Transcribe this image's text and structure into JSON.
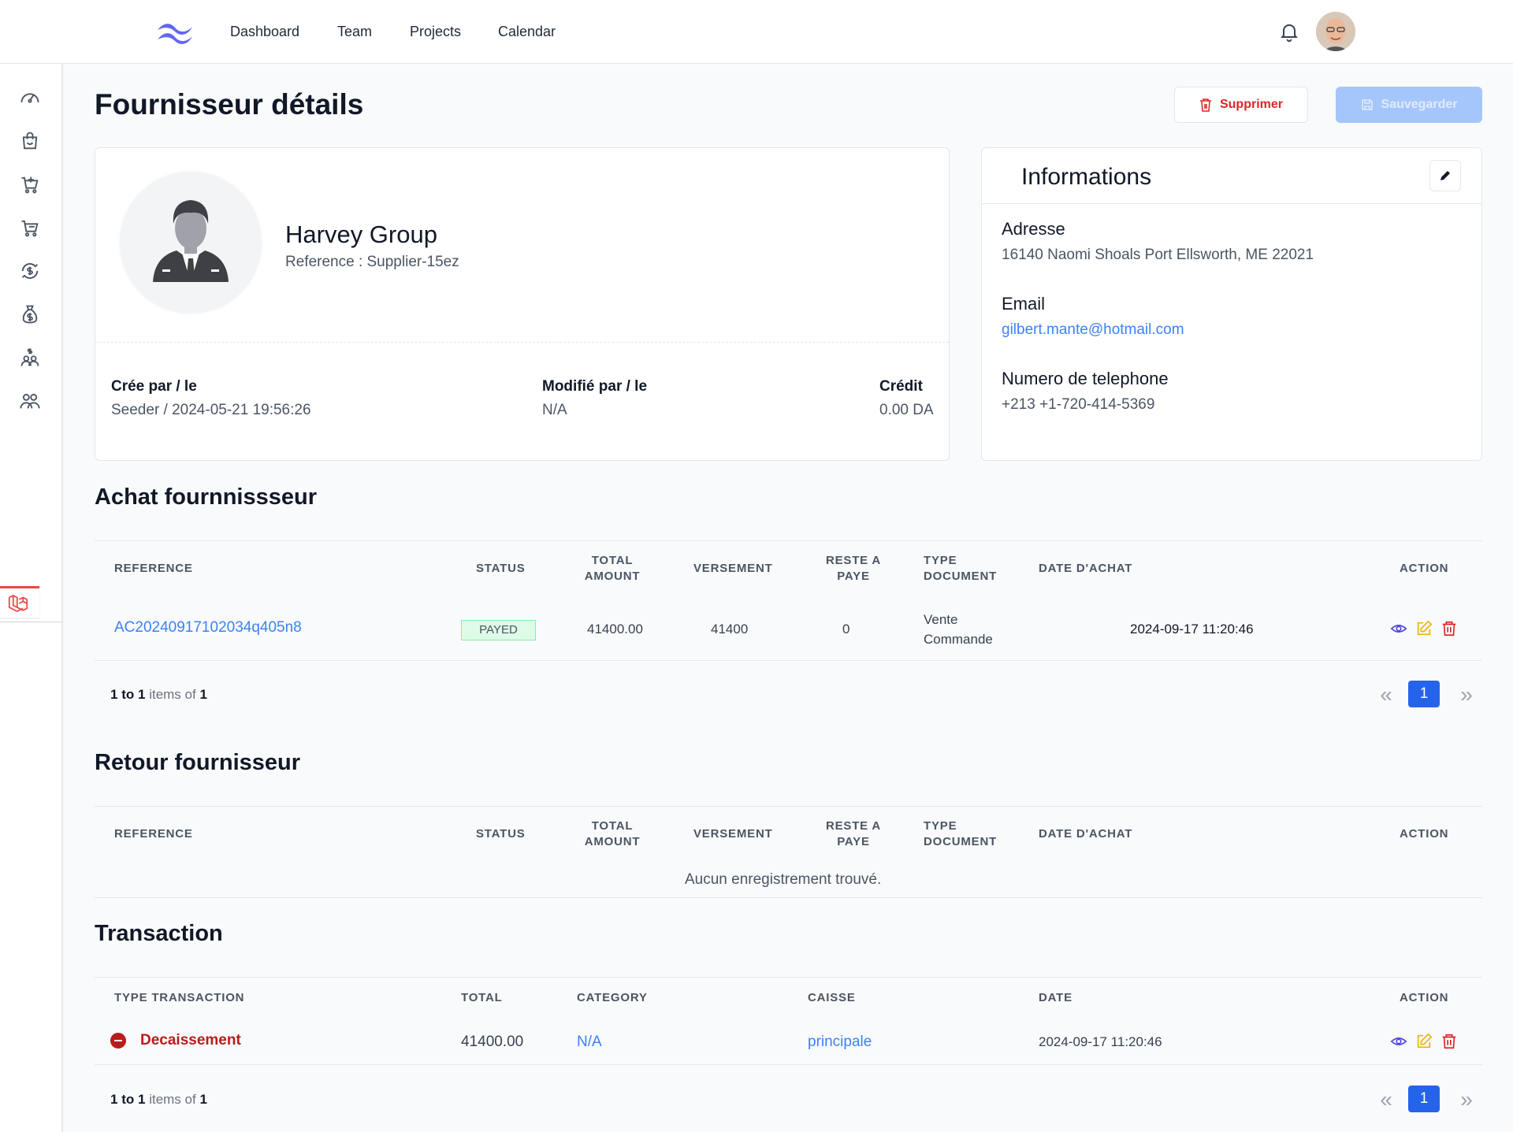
{
  "nav": {
    "links": [
      "Dashboard",
      "Team",
      "Projects",
      "Calendar"
    ]
  },
  "sidebar": {
    "icons": [
      "dashboard-gauge-icon",
      "shopping-bag-icon",
      "cart-add-icon",
      "cart-icon",
      "refresh-dollar-icon",
      "money-bag-icon",
      "users-dollar-icon",
      "users-icon"
    ]
  },
  "page": {
    "title": "Fournisseur détails",
    "delete_label": "Supprimer",
    "save_label": "Sauvegarder"
  },
  "supplier": {
    "name": "Harvey Group",
    "reference": "Reference : Supplier-15ez",
    "created_label": "Crée par / le",
    "created_value": "Seeder / 2024-05-21 19:56:26",
    "modified_label": "Modifié par / le",
    "modified_value": "N/A",
    "credit_label": "Crédit",
    "credit_value": "0.00 DA"
  },
  "informations": {
    "title": "Informations",
    "address_label": "Adresse",
    "address_value": "16140 Naomi Shoals Port Ellsworth, ME 22021",
    "email_label": "Email",
    "email_value": "gilbert.mante@hotmail.com",
    "phone_label": "Numero de telephone",
    "phone_value": "+213 +1-720-414-5369"
  },
  "achat": {
    "title": "Achat fournnissseur",
    "headers": {
      "reference": "REFERENCE",
      "status": "STATUS",
      "total_amount": "TOTAL AMOUNT",
      "versement": "VERSEMENT",
      "reste": "RESTE A PAYE",
      "type_doc": "TYPE DOCUMENT",
      "date": "DATE D'ACHAT",
      "action": "ACTION"
    },
    "rows": [
      {
        "reference": "AC20240917102034q405n8",
        "status": "PAYED",
        "total_amount": "41400.00",
        "versement": "41400",
        "reste": "0",
        "type_doc": "Vente Commande",
        "date": "2024-09-17 11:20:46"
      }
    ],
    "pagination": {
      "from": "1",
      "to_word": "to",
      "to": "1",
      "items_of": "items of",
      "total": "1",
      "page": "1"
    }
  },
  "retour": {
    "title": "Retour fournisseur",
    "headers": {
      "reference": "REFERENCE",
      "status": "STATUS",
      "total_amount": "TOTAL AMOUNT",
      "versement": "VERSEMENT",
      "reste": "RESTE A PAYE",
      "type_doc": "TYPE DOCUMENT",
      "date": "DATE D'ACHAT",
      "action": "ACTION"
    },
    "empty": "Aucun enregistrement trouvé."
  },
  "transaction": {
    "title": "Transaction",
    "headers": {
      "type": "TYPE TRANSACTION",
      "total": "TOTAL",
      "category": "CATEGORY",
      "caisse": "CAISSE",
      "date": "DATE",
      "action": "ACTION"
    },
    "rows": [
      {
        "type": "Decaissement",
        "total": "41400.00",
        "category": "N/A",
        "caisse": "principale",
        "date": "2024-09-17 11:20:46"
      }
    ],
    "pagination": {
      "from": "1",
      "to_word": "to",
      "to": "1",
      "items_of": "items of",
      "total": "1",
      "page": "1"
    }
  },
  "colors": {
    "primary": "#2563eb",
    "danger": "#dc2626",
    "link": "#3b82f6",
    "badge_bg": "#dcfce7"
  }
}
